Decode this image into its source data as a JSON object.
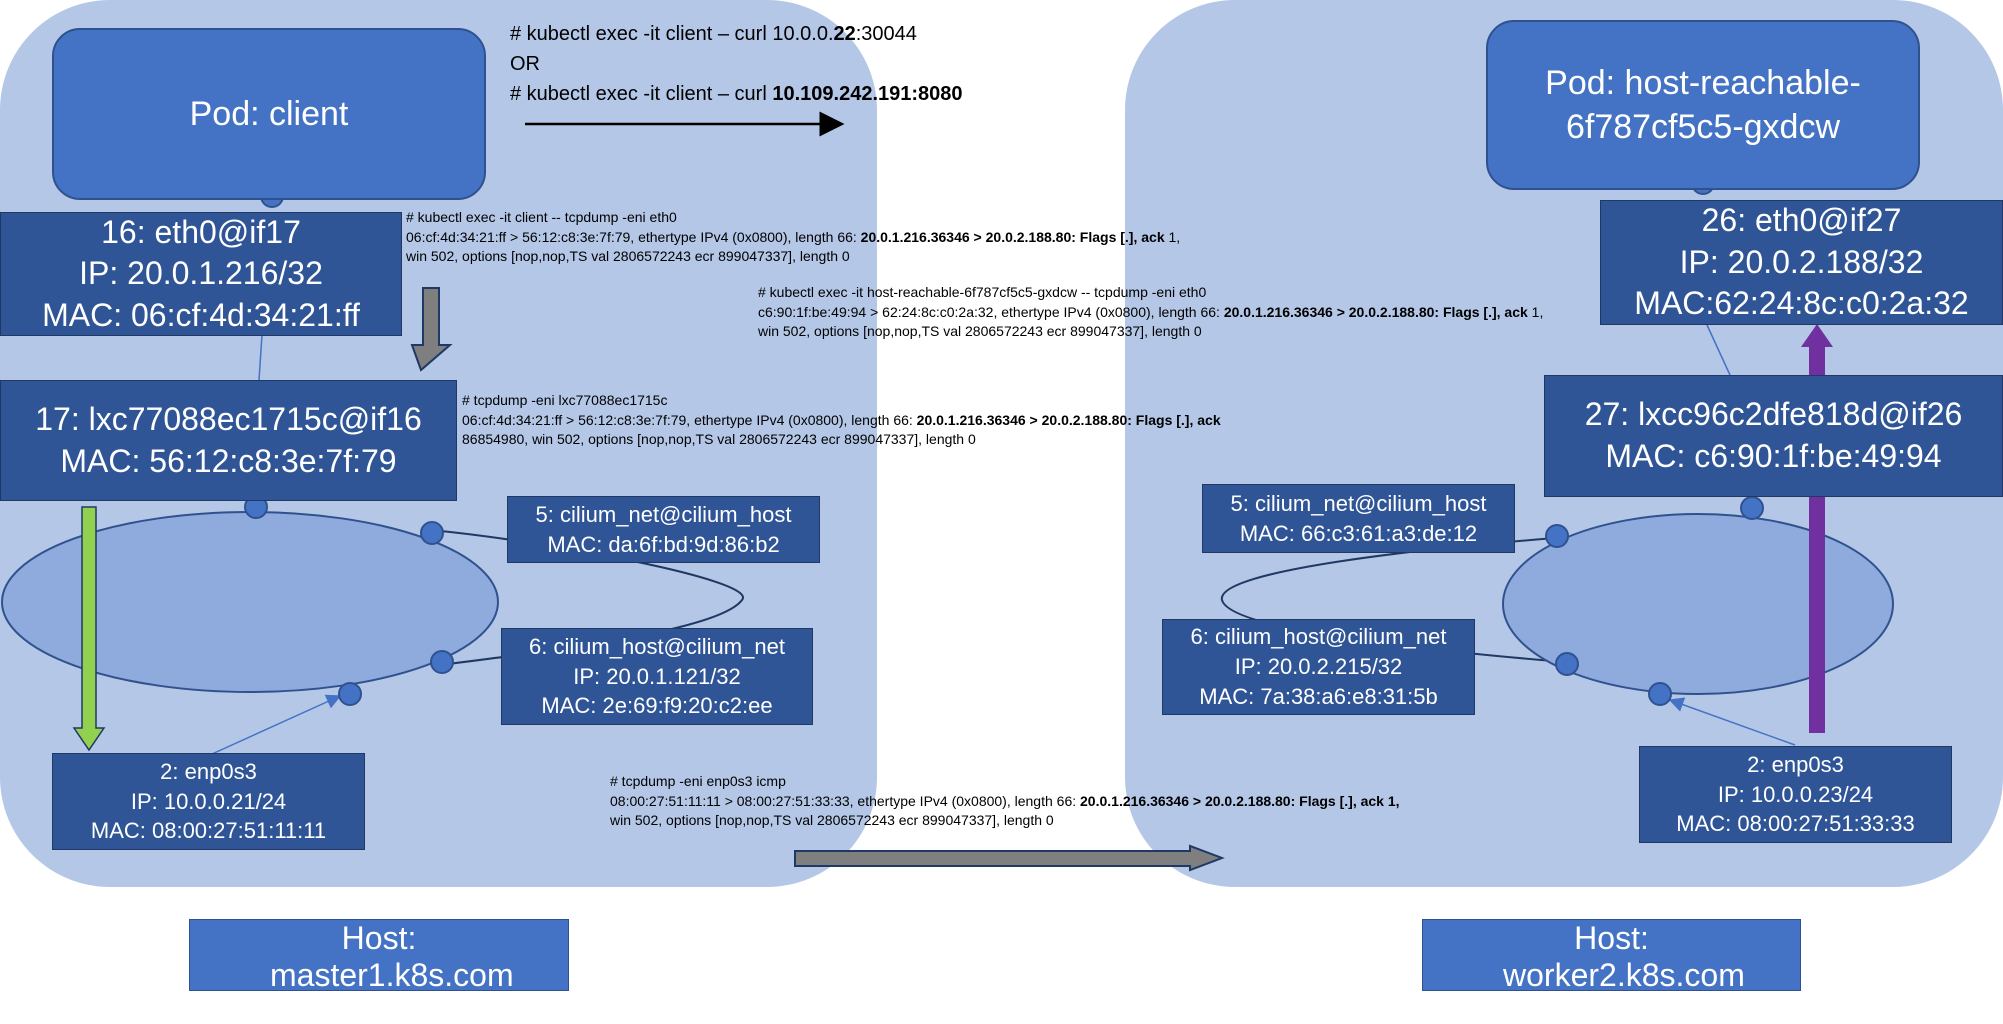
{
  "command": {
    "line1_pre": "# kubectl exec -it client – curl 10.0.0.",
    "line1_bold": "22",
    "line1_post": ":30044",
    "line2": "OR",
    "line3_pre": "# kubectl exec -it client – curl ",
    "line3_bold": "10.109.242.191:8080"
  },
  "master": {
    "host_label": "Host: master1.k8s.com",
    "pod": "Pod: client",
    "eth0": {
      "name": "16: eth0@if17",
      "ip": "IP: 20.0.1.216/32",
      "mac": "MAC: 06:cf:4d:34:21:ff"
    },
    "lxc": {
      "name": "17: lxc77088ec1715c@if16",
      "mac": "MAC: 56:12:c8:3e:7f:79"
    },
    "cilium_net": {
      "name": "5: cilium_net@cilium_host",
      "mac": "MAC: da:6f:bd:9d:86:b2"
    },
    "cilium_host": {
      "name": "6: cilium_host@cilium_net",
      "ip": "IP: 20.0.1.121/32",
      "mac": "MAC: 2e:69:f9:20:c2:ee"
    },
    "enp0s3": {
      "name": "2: enp0s3",
      "ip": "IP: 10.0.0.21/24",
      "mac": "MAC: 08:00:27:51:11:11"
    }
  },
  "worker": {
    "host_label": "Host: worker2.k8s.com",
    "pod": "Pod: host-reachable-6f787cf5c5-gxdcw",
    "eth0": {
      "name": "26: eth0@if27",
      "ip": "IP: 20.0.2.188/32",
      "mac": "MAC:62:24:8c:c0:2a:32"
    },
    "lxc": {
      "name": "27: lxcc96c2dfe818d@if26",
      "mac": "MAC: c6:90:1f:be:49:94"
    },
    "cilium_net": {
      "name": "5: cilium_net@cilium_host",
      "mac": "MAC: 66:c3:61:a3:de:12"
    },
    "cilium_host": {
      "name": "6: cilium_host@cilium_net",
      "ip": "IP: 20.0.2.215/32",
      "mac": "MAC: 7a:38:a6:e8:31:5b"
    },
    "enp0s3": {
      "name": "2: enp0s3",
      "ip": "IP: 10.0.0.23/24",
      "mac": "MAC: 08:00:27:51:33:33"
    }
  },
  "dumps": {
    "client_eth0": {
      "l1": "# kubectl exec -it client -- tcpdump -eni eth0",
      "l2_pre": "06:cf:4d:34:21:ff > 56:12:c8:3e:7f:79, ethertype IPv4 (0x0800), length 66: ",
      "l2_bold": "20.0.1.216.36346 > 20.0.2.188.80: Flags [.], ack",
      "l2_post": " 1,",
      "l3": "win 502, options [nop,nop,TS val 2806572243 ecr 899047337], length 0"
    },
    "server_eth0": {
      "l1": "# kubectl exec -it host-reachable-6f787cf5c5-gxdcw -- tcpdump -eni eth0",
      "l2_pre": "c6:90:1f:be:49:94 > 62:24:8c:c0:2a:32, ethertype IPv4 (0x0800), length 66: ",
      "l2_bold": "20.0.1.216.36346 > 20.0.2.188.80: Flags [.], ack",
      "l2_post": " 1,",
      "l3": "win 502, options [nop,nop,TS val 2806572243 ecr 899047337], length 0"
    },
    "lxc": {
      "l1": "# tcpdump -eni lxc77088ec1715c",
      "l2_pre": "06:cf:4d:34:21:ff > 56:12:c8:3e:7f:79, ethertype IPv4 (0x0800), length 66: ",
      "l2_bold": "20.0.1.216.36346 > 20.0.2.188.80: Flags [.], ack",
      "l3": "86854980, win 502, options [nop,nop,TS val 2806572243 ecr 899047337], length 0"
    },
    "enp0s3": {
      "l1": "# tcpdump -eni enp0s3 icmp",
      "l2_pre": "08:00:27:51:11:11 > 08:00:27:51:33:33, ethertype IPv4 (0x0800), length 66: ",
      "l2_bold": "20.0.1.216.36346 > 20.0.2.188.80: Flags [.], ack 1,",
      "l3": "win 502, options [nop,nop,TS val 2806572243 ecr 899047337], length 0"
    }
  }
}
